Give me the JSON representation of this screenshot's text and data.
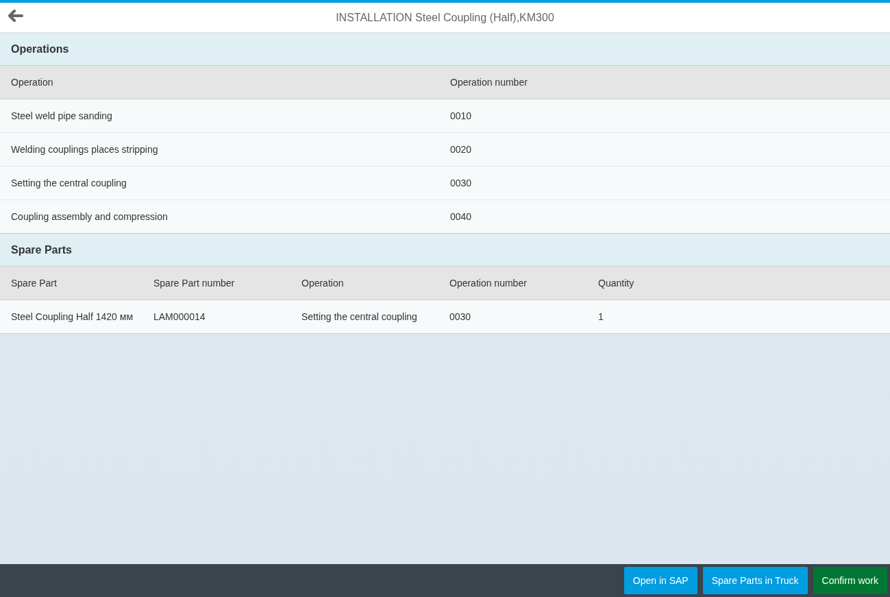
{
  "header": {
    "title": "INSTALLATION Steel Coupling (Half),KM300"
  },
  "operations": {
    "title": "Operations",
    "columns": [
      "Operation",
      "Operation number"
    ],
    "rows": [
      [
        "Steel weld pipe sanding",
        "0010"
      ],
      [
        "Welding couplings places stripping",
        "0020"
      ],
      [
        "Setting the central coupling",
        "0030"
      ],
      [
        "Coupling assembly and compression",
        "0040"
      ]
    ]
  },
  "spare_parts": {
    "title": "Spare Parts",
    "columns": [
      "Spare Part",
      "Spare Part number",
      "Operation",
      "Operation number",
      "Quantity"
    ],
    "rows": [
      [
        "Steel Coupling Half 1420 мм",
        "LAM000014",
        "Setting the central coupling",
        "0030",
        "1"
      ]
    ]
  },
  "footer": {
    "buttons": [
      {
        "label": "Open in SAP",
        "kind": "default"
      },
      {
        "label": "Spare Parts in Truck",
        "kind": "default"
      },
      {
        "label": "Confirm work",
        "kind": "accept"
      }
    ]
  }
}
